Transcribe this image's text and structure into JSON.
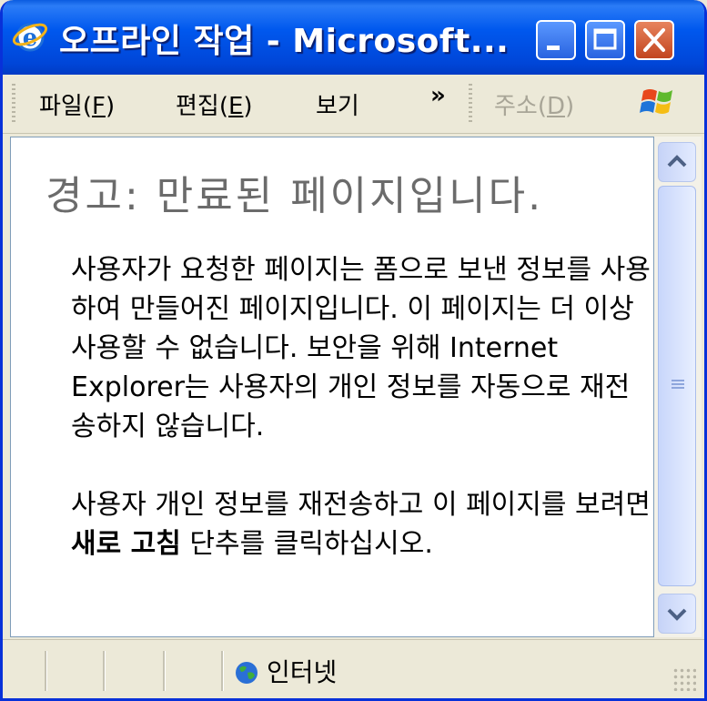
{
  "window": {
    "title": "오프라인 작업 - Microsoft...",
    "buttons": [
      "minimize",
      "maximize",
      "close"
    ]
  },
  "menubar": {
    "file": {
      "pre": "파일(",
      "key": "F",
      "post": ")"
    },
    "edit": {
      "pre": "편집(",
      "key": "E",
      "post": ")"
    },
    "view": "보기",
    "more": "»",
    "address": {
      "pre": "주소(",
      "key": "D",
      "post": ")"
    }
  },
  "content": {
    "heading": "경고: 만료된 페이지입니다.",
    "paragraph1": "사용자가 요청한 페이지는 폼으로 보낸 정보를 사용하여 만들어진 페이지입니다. 이 페이지는 더 이상 사용할 수 없습니다. 보안을 위해 Internet Explorer는 사용자의 개인 정보를 자동으로 재전송하지 않습니다.",
    "paragraph2_pre": "사용자 개인 정보를 재전송하고 이 페이지를 보려면 ",
    "paragraph2_bold": "새로 고침",
    "paragraph2_post": " 단추를 클릭하십시오."
  },
  "statusbar": {
    "zone_label": "인터넷",
    "zone_icon": "globe-icon"
  },
  "colors": {
    "titlebar": "#0058ee",
    "close_button": "#c2451f",
    "heading_text": "#6b6b6b"
  }
}
